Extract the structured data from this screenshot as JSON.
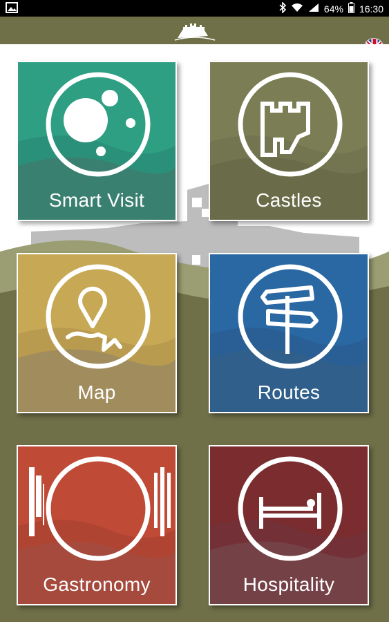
{
  "status_bar": {
    "battery_percent": "64%",
    "time": "16:30"
  },
  "app_bar": {
    "logo_icon": "castle-logo-icon",
    "language_icon": "uk-flag-icon"
  },
  "tiles": [
    {
      "label": "Smart Visit",
      "icon": "smart-visit-bubbles-icon",
      "color": "#2e9f83"
    },
    {
      "label": "Castles",
      "icon": "castle-tower-icon",
      "color": "#7b7d55"
    },
    {
      "label": "Map",
      "icon": "map-pin-icon",
      "color": "#c7a955"
    },
    {
      "label": "Routes",
      "icon": "signpost-icon",
      "color": "#2a68a3"
    },
    {
      "label": "Gastronomy",
      "icon": "plate-cutlery-icon",
      "color": "#bf4a35"
    },
    {
      "label": "Hospitality",
      "icon": "bed-icon",
      "color": "#7a2c2e"
    }
  ]
}
